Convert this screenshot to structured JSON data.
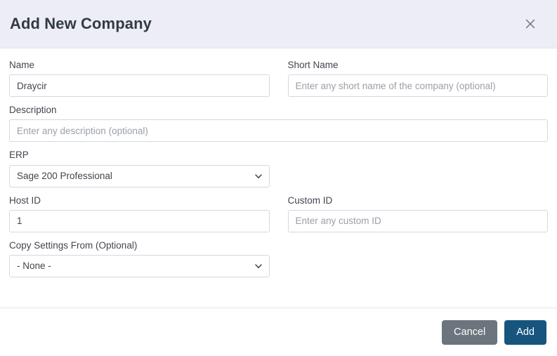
{
  "dialog": {
    "title": "Add New Company",
    "close_icon": "close-icon",
    "header_bg": "#ecedf5"
  },
  "form": {
    "name": {
      "label": "Name",
      "value": "Draycir",
      "placeholder": ""
    },
    "short_name": {
      "label": "Short Name",
      "value": "",
      "placeholder": "Enter any short name of the company (optional)"
    },
    "description": {
      "label": "Description",
      "value": "",
      "placeholder": "Enter any description (optional)"
    },
    "erp": {
      "label": "ERP",
      "value": "Sage 200 Professional",
      "chevron_icon": "chevron-down-icon"
    },
    "host_id": {
      "label": "Host ID",
      "value": "1",
      "placeholder": ""
    },
    "custom_id": {
      "label": "Custom ID",
      "value": "",
      "placeholder": "Enter any custom ID"
    },
    "copy_settings_from": {
      "label": "Copy Settings From (Optional)",
      "value": "- None -",
      "chevron_icon": "chevron-down-icon"
    }
  },
  "footer": {
    "cancel_label": "Cancel",
    "add_label": "Add",
    "cancel_color": "#6c757d",
    "add_color": "#17557f"
  }
}
